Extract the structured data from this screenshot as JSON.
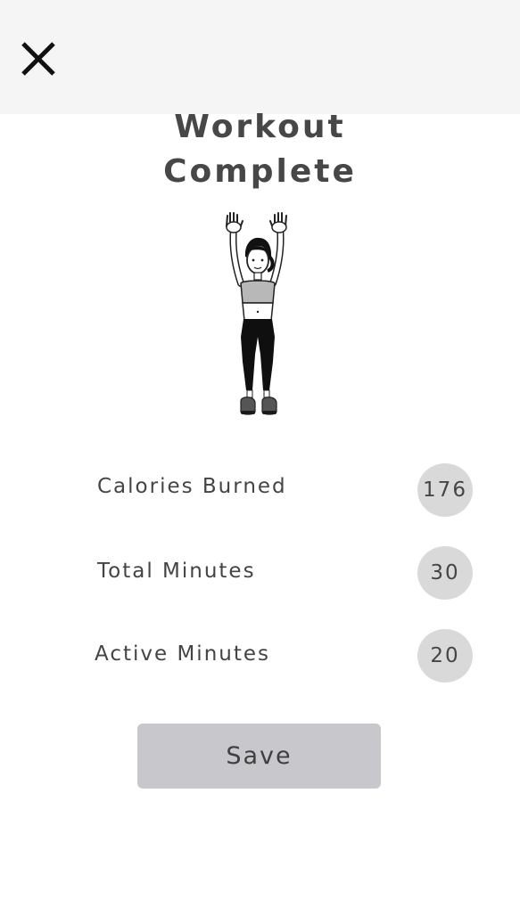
{
  "header": {
    "close_icon": "close-icon"
  },
  "title": {
    "line1": "Workout",
    "line2": "Complete"
  },
  "illustration": {
    "icon": "woman-arms-raised-illustration"
  },
  "stats": [
    {
      "label": "Calories Burned",
      "value": "176"
    },
    {
      "label": "Total Minutes",
      "value": "30"
    },
    {
      "label": "Active Minutes",
      "value": "20"
    }
  ],
  "actions": {
    "save_label": "Save"
  },
  "colors": {
    "header_bg": "#f5f5f5",
    "badge_bg": "#d9d9d9",
    "button_bg": "#c8c8cc",
    "text": "#454545"
  }
}
